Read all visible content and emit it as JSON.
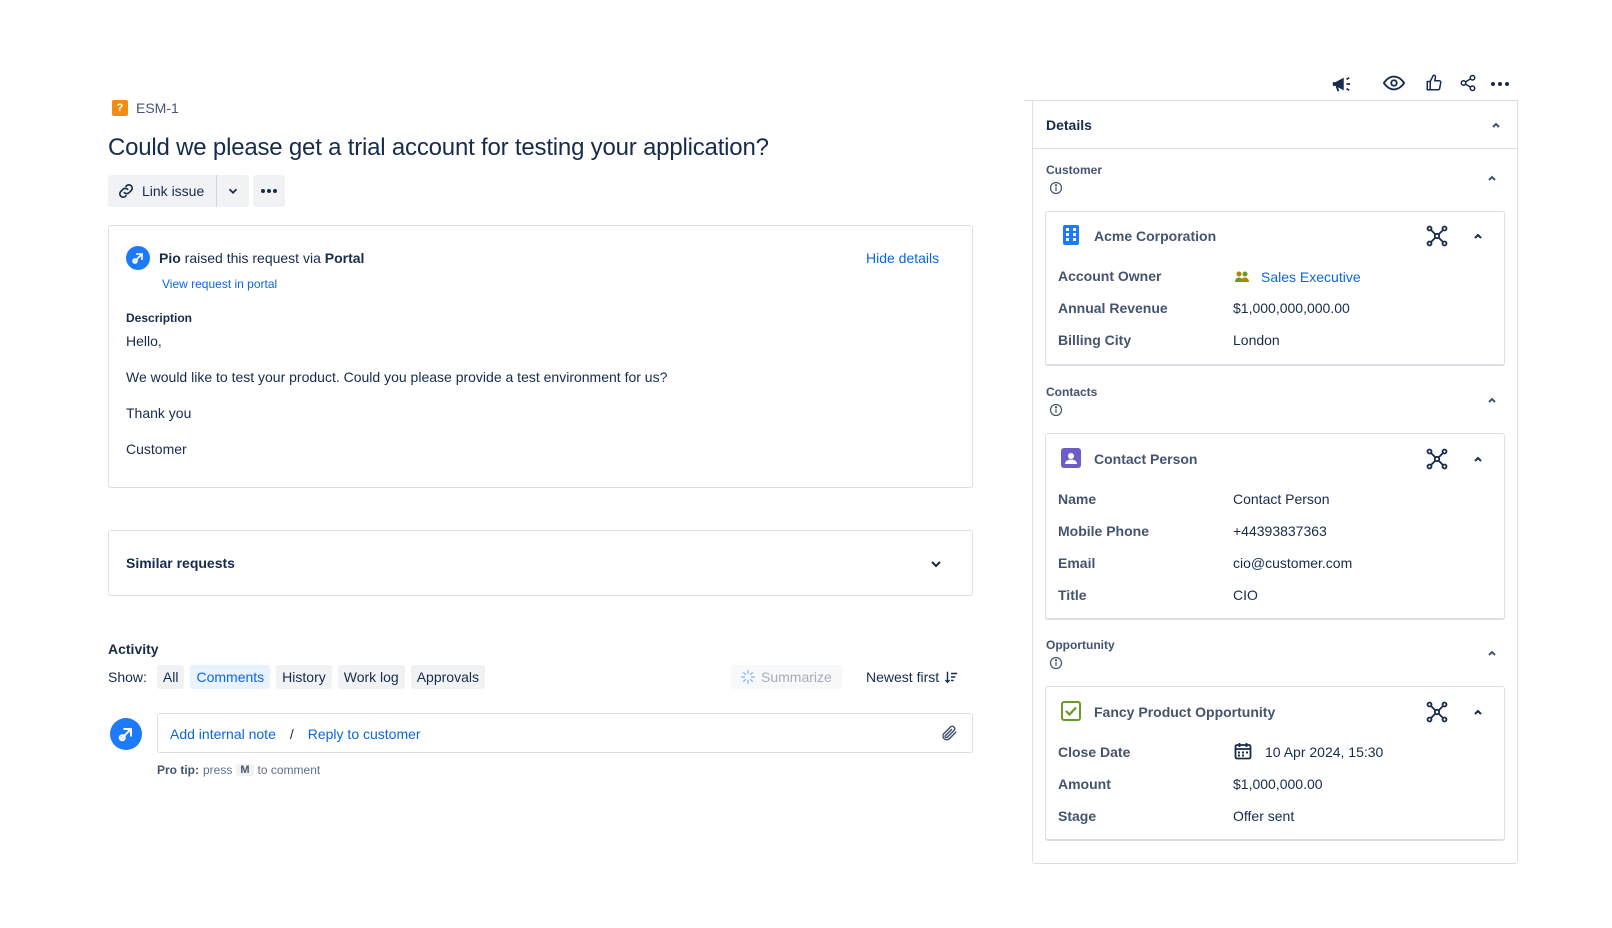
{
  "issue": {
    "key": "ESM-1",
    "type_icon": "question-icon",
    "title": "Could we please get a trial account for testing your application?"
  },
  "toolbar": {
    "link_issue_label": "Link issue"
  },
  "request": {
    "reporter_name": "Pio",
    "raised_text": "raised this request via",
    "channel": "Portal",
    "view_portal_label": "View request in portal",
    "hide_details_label": "Hide details",
    "description_label": "Description",
    "description_lines": [
      "Hello,",
      "We would like to test your product. Could you please provide a test environment for us?",
      "Thank you",
      "Customer"
    ]
  },
  "similar": {
    "label": "Similar requests"
  },
  "activity": {
    "label": "Activity",
    "show_label": "Show:",
    "filters": [
      {
        "label": "All",
        "selected": false
      },
      {
        "label": "Comments",
        "selected": true
      },
      {
        "label": "History",
        "selected": false
      },
      {
        "label": "Work log",
        "selected": false
      },
      {
        "label": "Approvals",
        "selected": false
      }
    ],
    "summarize_label": "Summarize",
    "sort_label": "Newest first"
  },
  "comment": {
    "internal_note_label": "Add internal note",
    "separator": "/",
    "reply_label": "Reply to customer",
    "protip_prefix": "Pro tip:",
    "protip_press": "press",
    "protip_key": "M",
    "protip_suffix": "to comment"
  },
  "details": {
    "title": "Details",
    "sections": [
      {
        "label": "Customer",
        "object": {
          "name": "Acme Corporation",
          "icon": "building-icon",
          "fields": [
            {
              "label": "Account Owner",
              "value": "Sales Executive",
              "link": true,
              "icon": "user-group-icon"
            },
            {
              "label": "Annual Revenue",
              "value": "$1,000,000,000.00"
            },
            {
              "label": "Billing City",
              "value": "London"
            }
          ]
        }
      },
      {
        "label": "Contacts",
        "object": {
          "name": "Contact Person",
          "icon": "contact-card-icon",
          "fields": [
            {
              "label": "Name",
              "value": "Contact Person"
            },
            {
              "label": "Mobile Phone",
              "value": "+44393837363"
            },
            {
              "label": "Email",
              "value": "cio@customer.com"
            },
            {
              "label": "Title",
              "value": "CIO"
            }
          ]
        }
      },
      {
        "label": "Opportunity",
        "object": {
          "name": "Fancy Product Opportunity",
          "icon": "checkbox-icon",
          "fields": [
            {
              "label": "Close Date",
              "value": "10 Apr 2024, 15:30",
              "icon": "calendar-icon"
            },
            {
              "label": "Amount",
              "value": "$1,000,000.00"
            },
            {
              "label": "Stage",
              "value": "Offer sent"
            }
          ]
        }
      }
    ]
  },
  "colors": {
    "link": "#0c66e4",
    "text": "#172b4d",
    "border": "#dcdfe4",
    "type_orange": "#f18d13"
  }
}
